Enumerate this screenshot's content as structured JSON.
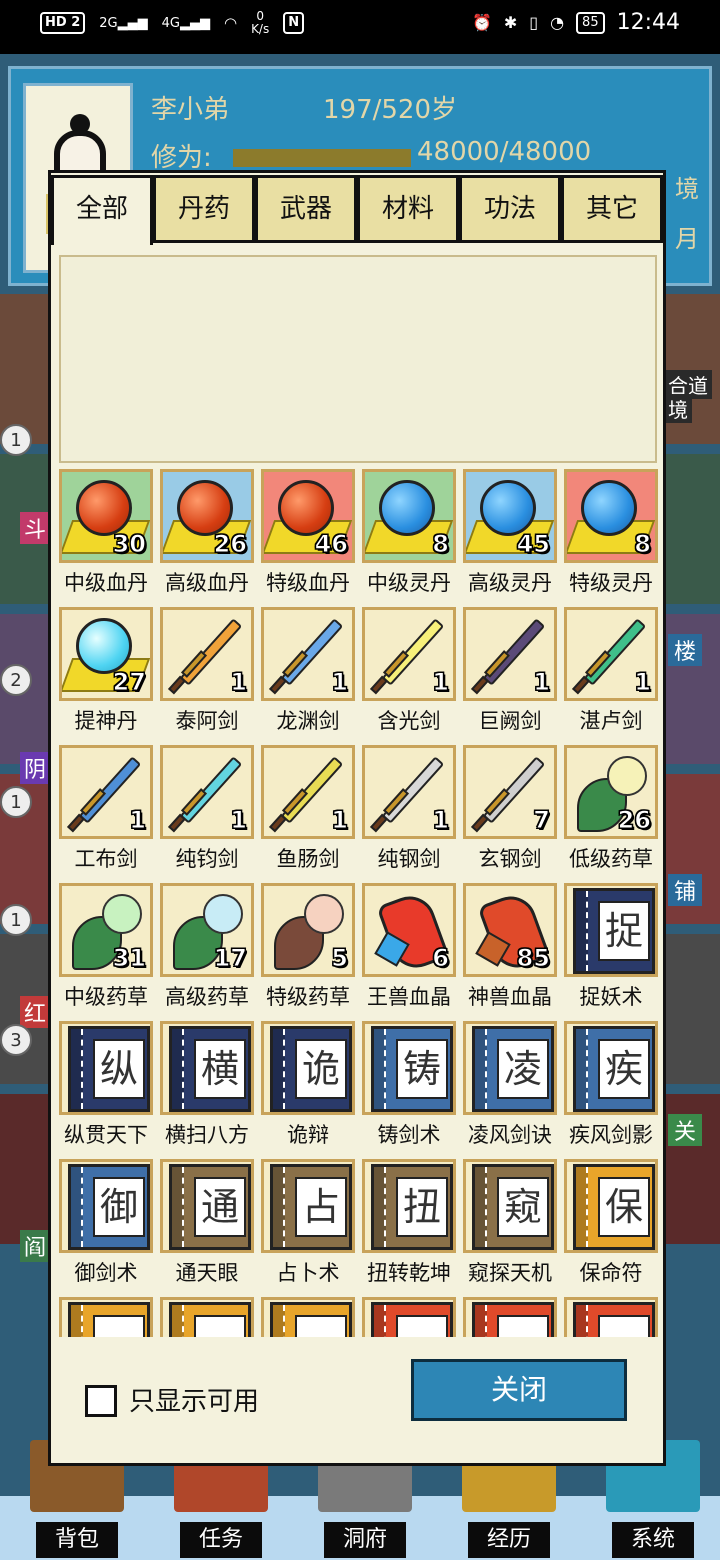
{
  "status_bar": {
    "hd_label": "HD",
    "sim_label": "2",
    "signal1": "2G",
    "signal2": "4G",
    "speed_value": "0",
    "speed_unit": "K/s",
    "nfc_label": "N",
    "battery": "85",
    "time": "12:44"
  },
  "profile": {
    "name": "李小弟",
    "age": "197/520岁",
    "cultivation_label": "修为:",
    "cultivation_value": "48000/48000",
    "cultivation_fraction": 1.0,
    "side_text": [
      "境",
      "月"
    ]
  },
  "background_labels": {
    "left": [
      "斗",
      "阴",
      "红",
      "阎"
    ],
    "right": [
      "楼",
      "铺",
      "关"
    ],
    "badges": [
      "1",
      "2",
      "1",
      "1",
      "3"
    ],
    "top_right": [
      "合道",
      "境"
    ]
  },
  "dialog": {
    "tabs": [
      {
        "label": "全部",
        "active": true
      },
      {
        "label": "丹药",
        "active": false
      },
      {
        "label": "武器",
        "active": false
      },
      {
        "label": "材料",
        "active": false
      },
      {
        "label": "功法",
        "active": false
      },
      {
        "label": "其它",
        "active": false
      }
    ],
    "items": [
      {
        "name": "中级血丹",
        "count": "30",
        "icon": "red-pill-icon",
        "bg": "green"
      },
      {
        "name": "高级血丹",
        "count": "26",
        "icon": "red-pill-icon",
        "bg": "blue"
      },
      {
        "name": "特级血丹",
        "count": "46",
        "icon": "red-pill-icon",
        "bg": "red"
      },
      {
        "name": "中级灵丹",
        "count": "8",
        "icon": "blue-pill-icon",
        "bg": "green"
      },
      {
        "name": "高级灵丹",
        "count": "45",
        "icon": "blue-pill-icon",
        "bg": "blue"
      },
      {
        "name": "特级灵丹",
        "count": "8",
        "icon": "blue-pill-icon",
        "bg": "red"
      },
      {
        "name": "提神丹",
        "count": "27",
        "icon": "cyan-pill-icon",
        "bg": "cream"
      },
      {
        "name": "泰阿剑",
        "count": "1",
        "icon": "sword-icon",
        "color": "#f0a23a",
        "bg": "cream"
      },
      {
        "name": "龙渊剑",
        "count": "1",
        "icon": "sword-icon",
        "color": "#6aa8e8",
        "bg": "cream"
      },
      {
        "name": "含光剑",
        "count": "1",
        "icon": "sword-icon",
        "color": "#f7f07a",
        "bg": "cream"
      },
      {
        "name": "巨阙剑",
        "count": "1",
        "icon": "sword-icon",
        "color": "#5b4a78",
        "bg": "cream"
      },
      {
        "name": "湛卢剑",
        "count": "1",
        "icon": "sword-icon",
        "color": "#3fbf8a",
        "bg": "cream"
      },
      {
        "name": "工布剑",
        "count": "1",
        "icon": "sword-icon",
        "color": "#4f8fd6",
        "bg": "cream"
      },
      {
        "name": "纯钧剑",
        "count": "1",
        "icon": "sword-icon",
        "color": "#62d4e0",
        "bg": "cream"
      },
      {
        "name": "鱼肠剑",
        "count": "1",
        "icon": "sword-icon",
        "color": "#e8dc54",
        "bg": "cream"
      },
      {
        "name": "纯钢剑",
        "count": "1",
        "icon": "sword-icon",
        "color": "#d8d8d8",
        "bg": "cream"
      },
      {
        "name": "玄钢剑",
        "count": "7",
        "icon": "sword-icon",
        "color": "#cfcfcf",
        "bg": "cream"
      },
      {
        "name": "低级药草",
        "count": "26",
        "icon": "herb-icon",
        "color": "#f6f2b8",
        "bg": "cream"
      },
      {
        "name": "中级药草",
        "count": "31",
        "icon": "herb-icon",
        "color": "#c8f2c0",
        "bg": "cream"
      },
      {
        "name": "高级药草",
        "count": "17",
        "icon": "herb-icon",
        "color": "#c8ecf6",
        "bg": "cream"
      },
      {
        "name": "特级药草",
        "count": "5",
        "icon": "herb-icon",
        "color": "#f6d2c0",
        "bg": "cream"
      },
      {
        "name": "王兽血晶",
        "count": "6",
        "icon": "crystal-icon",
        "color": "#e83a2a",
        "bg": "cream"
      },
      {
        "name": "神兽血晶",
        "count": "85",
        "icon": "crystal-icon",
        "color": "#e04a2a",
        "bg": "cream"
      },
      {
        "name": "捉妖术",
        "count": "",
        "icon": "book-icon",
        "glyph": "捉",
        "color": "#2a3a6a",
        "bg": "cream"
      },
      {
        "name": "纵贯天下",
        "count": "",
        "icon": "book-icon",
        "glyph": "纵",
        "color": "#2a3a6a",
        "bg": "cream"
      },
      {
        "name": "横扫八方",
        "count": "",
        "icon": "book-icon",
        "glyph": "横",
        "color": "#2a3a6a",
        "bg": "cream"
      },
      {
        "name": "诡辩",
        "count": "",
        "icon": "book-icon",
        "glyph": "诡",
        "color": "#2a3a6a",
        "bg": "cream"
      },
      {
        "name": "铸剑术",
        "count": "",
        "icon": "book-icon",
        "glyph": "铸",
        "color": "#3f6fa8",
        "bg": "cream"
      },
      {
        "name": "凌风剑诀",
        "count": "",
        "icon": "book-icon",
        "glyph": "凌",
        "color": "#3f6fa8",
        "bg": "cream"
      },
      {
        "name": "疾风剑影",
        "count": "",
        "icon": "book-icon",
        "glyph": "疾",
        "color": "#3f6fa8",
        "bg": "cream"
      },
      {
        "name": "御剑术",
        "count": "",
        "icon": "book-icon",
        "glyph": "御",
        "color": "#3f6fa8",
        "bg": "cream"
      },
      {
        "name": "通天眼",
        "count": "",
        "icon": "book-icon",
        "glyph": "通",
        "color": "#8a7048",
        "bg": "cream"
      },
      {
        "name": "占卜术",
        "count": "",
        "icon": "book-icon",
        "glyph": "占",
        "color": "#8a7048",
        "bg": "cream"
      },
      {
        "name": "扭转乾坤",
        "count": "",
        "icon": "book-icon",
        "glyph": "扭",
        "color": "#8a7048",
        "bg": "cream"
      },
      {
        "name": "窥探天机",
        "count": "",
        "icon": "book-icon",
        "glyph": "窥",
        "color": "#8a7048",
        "bg": "cream"
      },
      {
        "name": "保命符",
        "count": "",
        "icon": "book-icon",
        "glyph": "保",
        "color": "#e8a52a",
        "bg": "cream"
      },
      {
        "name": "",
        "count": "",
        "icon": "book-icon",
        "glyph": "",
        "color": "#e8a52a",
        "bg": "cream"
      },
      {
        "name": "",
        "count": "",
        "icon": "book-icon",
        "glyph": "",
        "color": "#e8a52a",
        "bg": "cream"
      },
      {
        "name": "",
        "count": "",
        "icon": "book-icon",
        "glyph": "",
        "color": "#e8a52a",
        "bg": "cream"
      },
      {
        "name": "",
        "count": "",
        "icon": "book-icon",
        "glyph": "",
        "color": "#e04a2a",
        "bg": "cream"
      },
      {
        "name": "",
        "count": "",
        "icon": "book-icon",
        "glyph": "",
        "color": "#e04a2a",
        "bg": "cream"
      },
      {
        "name": "",
        "count": "",
        "icon": "book-icon",
        "glyph": "",
        "color": "#e04a2a",
        "bg": "cream"
      }
    ],
    "filter_label": "只显示可用",
    "filter_checked": false,
    "close_label": "关闭"
  },
  "bottom_nav": [
    {
      "label": "背包",
      "icon": "backpack-icon",
      "color": "#8a5a2a"
    },
    {
      "label": "任务",
      "icon": "task-icon",
      "color": "#b0472a"
    },
    {
      "label": "洞府",
      "icon": "cave-icon",
      "color": "#7a7a7a"
    },
    {
      "label": "经历",
      "icon": "experience-icon",
      "color": "#c89a2a"
    },
    {
      "label": "系统",
      "icon": "system-icon",
      "color": "#2a9ab8"
    }
  ],
  "colors": {
    "dialog_bg": "#f4f2dd",
    "tab_inactive": "#e9dfa3",
    "tile_border": "#c8a35a",
    "close_button": "#2d86b5",
    "profile_bg": "#2a8dbb"
  }
}
